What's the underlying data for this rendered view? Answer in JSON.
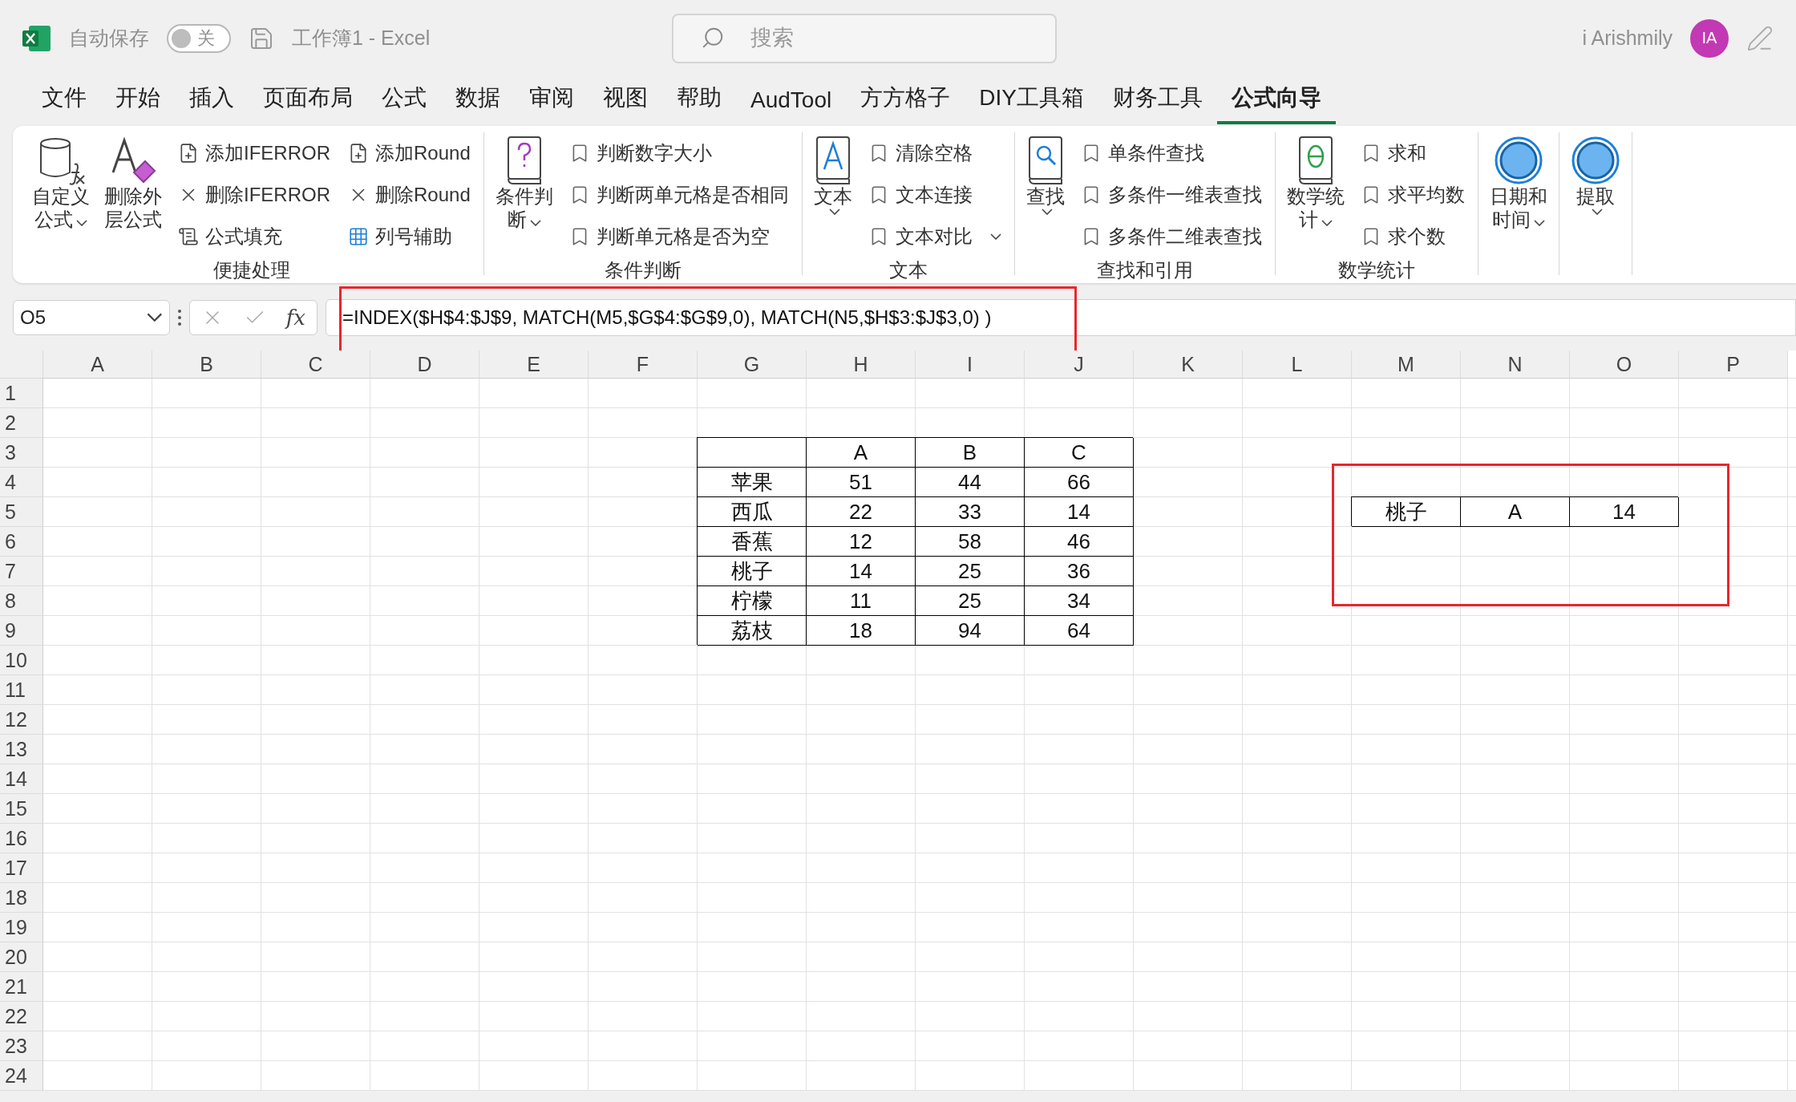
{
  "title_bar": {
    "autosave_label": "自动保存",
    "autosave": {
      "on": false,
      "label": "关"
    },
    "document_title": "工作簿1  -  Excel",
    "search": {
      "placeholder": "搜索"
    },
    "user_name": "i Arishmily",
    "avatar_initials": "IA"
  },
  "tabs": [
    {
      "label": "文件",
      "selected": false
    },
    {
      "label": "开始",
      "selected": false
    },
    {
      "label": "插入",
      "selected": false
    },
    {
      "label": "页面布局",
      "selected": false
    },
    {
      "label": "公式",
      "selected": false
    },
    {
      "label": "数据",
      "selected": false
    },
    {
      "label": "审阅",
      "selected": false
    },
    {
      "label": "视图",
      "selected": false
    },
    {
      "label": "帮助",
      "selected": false
    },
    {
      "label": "AudTool",
      "selected": false
    },
    {
      "label": "方方格子",
      "selected": false
    },
    {
      "label": "DIY工具箱",
      "selected": false
    },
    {
      "label": "财务工具",
      "selected": false
    },
    {
      "label": "公式向导",
      "selected": true
    }
  ],
  "ribbon": {
    "groups": [
      {
        "label": "便捷处理",
        "large": [
          {
            "lines": [
              "自定义",
              "公式"
            ],
            "dropdown": true
          },
          {
            "lines": [
              "删除外",
              "层公式"
            ],
            "dropdown": false
          }
        ],
        "small_columns": [
          [
            {
              "label": "添加IFERROR",
              "dropdown": false
            },
            {
              "label": "删除IFERROR",
              "dropdown": false
            },
            {
              "label": "公式填充",
              "dropdown": false
            }
          ],
          [
            {
              "label": "添加Round",
              "dropdown": false
            },
            {
              "label": "删除Round",
              "dropdown": false
            },
            {
              "label": "列号辅助",
              "dropdown": false
            }
          ]
        ]
      },
      {
        "label": "条件判断",
        "large": [
          {
            "lines": [
              "条件判",
              "断"
            ],
            "dropdown": true
          }
        ],
        "small_columns": [
          [
            {
              "label": "判断数字大小",
              "dropdown": false
            },
            {
              "label": "判断两单元格是否相同",
              "dropdown": false
            },
            {
              "label": "判断单元格是否为空",
              "dropdown": false
            }
          ]
        ]
      },
      {
        "label": "文本",
        "large": [
          {
            "lines": [
              "文本"
            ],
            "dropdown": true
          }
        ],
        "small_columns": [
          [
            {
              "label": "清除空格",
              "dropdown": false
            },
            {
              "label": "文本连接",
              "dropdown": false
            },
            {
              "label": "文本对比",
              "dropdown": true
            }
          ]
        ]
      },
      {
        "label": "查找和引用",
        "large": [
          {
            "lines": [
              "查找"
            ],
            "dropdown": true
          }
        ],
        "small_columns": [
          [
            {
              "label": "单条件查找",
              "dropdown": false
            },
            {
              "label": "多条件一维表查找",
              "dropdown": false
            },
            {
              "label": "多条件二维表查找",
              "dropdown": false
            }
          ]
        ]
      },
      {
        "label": "数学统计",
        "large": [
          {
            "lines": [
              "数学统",
              "计"
            ],
            "dropdown": true
          }
        ],
        "small_columns": [
          [
            {
              "label": "求和",
              "dropdown": false
            },
            {
              "label": "求平均数",
              "dropdown": false
            },
            {
              "label": "求个数",
              "dropdown": false
            }
          ]
        ]
      },
      {
        "large": [
          {
            "lines": [
              "日期和",
              "时间"
            ],
            "dropdown": true
          }
        ]
      },
      {
        "large": [
          {
            "lines": [
              "提取"
            ],
            "dropdown": true
          }
        ]
      }
    ]
  },
  "formula_bar": {
    "name_box": "O5",
    "fx": "fx",
    "formula": "=INDEX($H$4:$J$9, MATCH(M5,$G$4:$G$9,0),  MATCH(N5,$H$3:$J$3,0) )"
  },
  "sheet": {
    "columns": [
      "A",
      "B",
      "C",
      "D",
      "E",
      "F",
      "G",
      "H",
      "I",
      "J",
      "K",
      "L",
      "M",
      "N",
      "O",
      "P"
    ],
    "rows": [
      "1",
      "2",
      "3",
      "4",
      "5",
      "6",
      "7",
      "8",
      "9",
      "10",
      "11",
      "12",
      "13",
      "14",
      "15",
      "16",
      "17",
      "18",
      "19",
      "20",
      "21",
      "22",
      "23",
      "24"
    ],
    "data_table": {
      "header": [
        "A",
        "B",
        "C"
      ],
      "rows": [
        {
          "name": "苹果",
          "values": [
            "51",
            "44",
            "66"
          ]
        },
        {
          "name": "西瓜",
          "values": [
            "22",
            "33",
            "14"
          ]
        },
        {
          "name": "香蕉",
          "values": [
            "12",
            "58",
            "46"
          ]
        },
        {
          "name": "桃子",
          "values": [
            "14",
            "25",
            "36"
          ]
        },
        {
          "name": "柠檬",
          "values": [
            "11",
            "25",
            "34"
          ]
        },
        {
          "name": "荔枝",
          "values": [
            "18",
            "94",
            "64"
          ]
        }
      ]
    },
    "lookup_result": [
      "桃子",
      "A",
      "14"
    ]
  }
}
